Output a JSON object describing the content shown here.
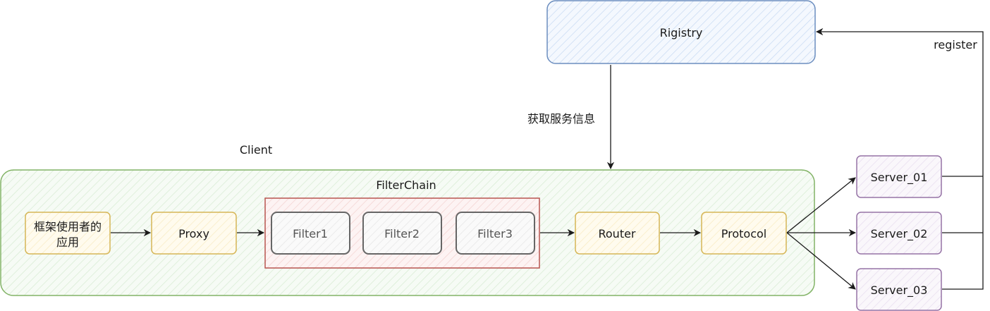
{
  "registry": {
    "label": "Rigistry"
  },
  "fetch_label": "获取服务信息",
  "client": {
    "label": "Client"
  },
  "filterchain": {
    "label": "FilterChain"
  },
  "nodes": {
    "app_line1": "框架使用者的",
    "app_line2": "应用",
    "proxy": "Proxy",
    "filter1": "Filter1",
    "filter2": "Filter2",
    "filter3": "Filter3",
    "router": "Router",
    "protocol": "Protocol"
  },
  "servers": [
    "Server_01",
    "Server_02",
    "Server_03"
  ],
  "register_label": "register",
  "colors": {
    "registry_stroke": "#6c8ebf",
    "registry_fill": "#dae8fc",
    "client_stroke": "#82b366",
    "client_fill": "#d5e8d4",
    "node_stroke": "#d6b656",
    "node_fill": "#fff2cc",
    "filterchain_stroke": "#b85450",
    "filterchain_fill": "#f8cecc",
    "filter_stroke": "#666666",
    "filter_fill": "#f5f5f5",
    "server_stroke": "#9673a6",
    "server_fill": "#e1d5e7"
  }
}
